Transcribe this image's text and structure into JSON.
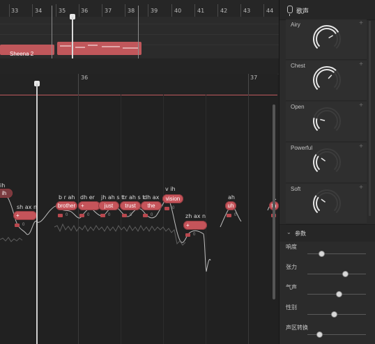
{
  "top_ruler": {
    "bars": [
      "33",
      "34",
      "35",
      "36",
      "37",
      "38",
      "39",
      "40",
      "41",
      "42",
      "43",
      "44"
    ]
  },
  "tracks": {
    "clip_label": "Sheena 2"
  },
  "piano_ruler": {
    "bars": [
      "36",
      "37"
    ]
  },
  "notes": [
    {
      "lyric": "ih",
      "phon": "ih"
    },
    {
      "lyric": "+",
      "phon": "sh ax n"
    },
    {
      "lyric": "brother",
      "phon": "b r ah"
    },
    {
      "lyric": "+",
      "phon": "dh er"
    },
    {
      "lyric": "just",
      "phon": "jh ah s t"
    },
    {
      "lyric": "trust",
      "phon": "tr ah s t"
    },
    {
      "lyric": "the",
      "phon": "dh ax"
    },
    {
      "lyric": "vision",
      "phon": "v ih"
    },
    {
      "lyric": "+",
      "phon": "zh ax n"
    },
    {
      "lyric": "uh",
      "phon": "ah"
    },
    {
      "lyric": "th",
      "phon": ""
    }
  ],
  "note_meta": {
    "mini_value": "0"
  },
  "panel": {
    "title": "歌声",
    "add_symbol": "+",
    "knobs": [
      {
        "label": "Airy",
        "value": 0.72
      },
      {
        "label": "Chest",
        "value": 0.66
      },
      {
        "label": "Open",
        "value": 0.22
      },
      {
        "label": "Powerful",
        "value": 0.3
      },
      {
        "label": "Soft",
        "value": 0.3
      }
    ],
    "params_title": "参数",
    "params_caret": "⌄",
    "params": [
      {
        "label": "响度",
        "value": 0.24
      },
      {
        "label": "张力",
        "value": 0.64
      },
      {
        "label": "气声",
        "value": 0.53
      },
      {
        "label": "性别",
        "value": 0.45
      },
      {
        "label": "声区转换",
        "value": 0.2
      }
    ]
  },
  "colors": {
    "note": "#c5545a",
    "clip": "#c0575b",
    "accent_line": "#c05a5e"
  }
}
